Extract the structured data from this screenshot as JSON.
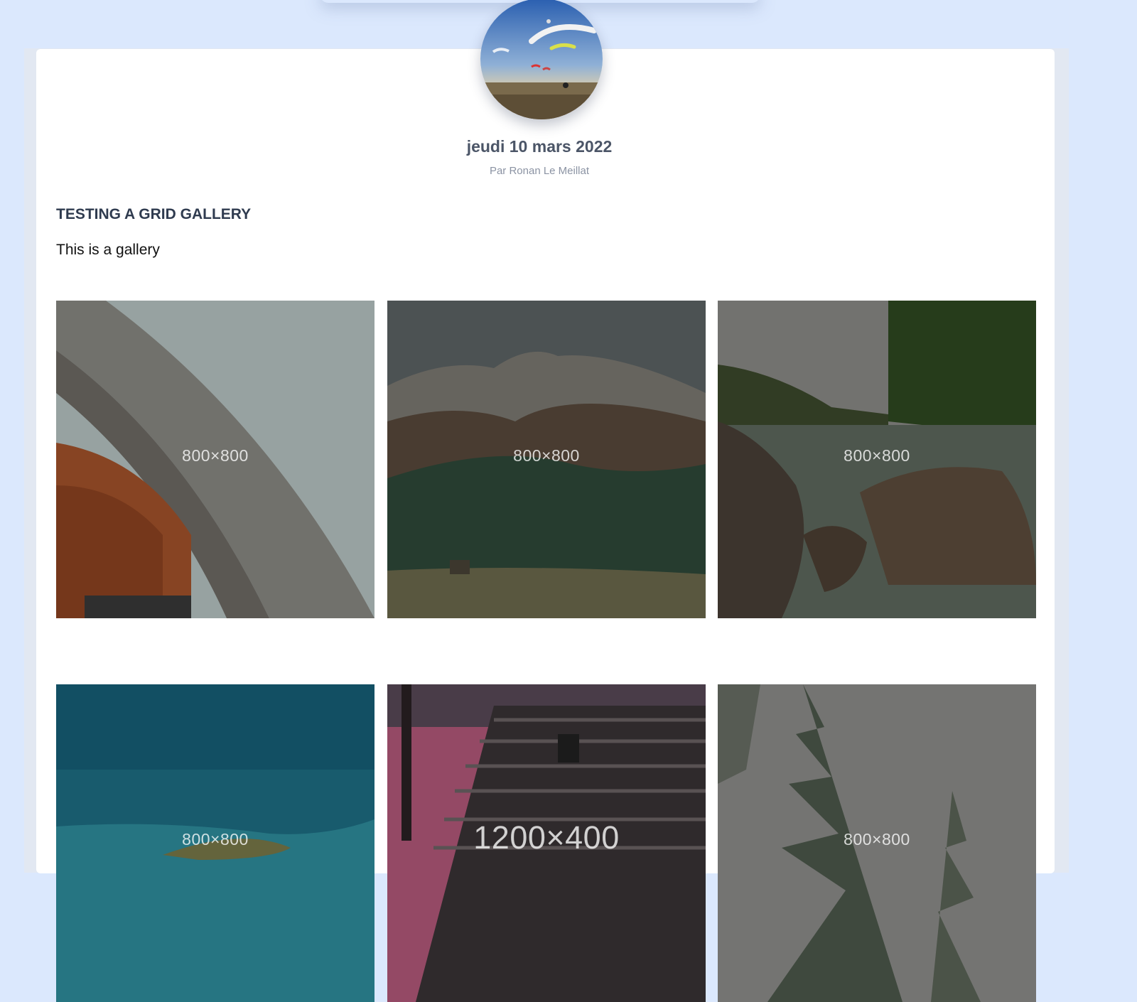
{
  "post": {
    "date": "jeudi 10 mars 2022",
    "author": "Par Ronan Le Meillat",
    "title": "TESTING A GRID GALLERY",
    "body": "This is a gallery"
  },
  "gallery": {
    "items": [
      {
        "label": "800×800"
      },
      {
        "label": "800×800"
      },
      {
        "label": "800×800"
      },
      {
        "label": "800×800"
      },
      {
        "label": "1200×400"
      },
      {
        "label": "800×800"
      }
    ]
  },
  "colors": {
    "page_background": "#dbe8fd",
    "card_background": "#ffffff",
    "date_text": "#4b5567",
    "author_text": "#8b93a3",
    "title_text": "#2f3b4f"
  }
}
